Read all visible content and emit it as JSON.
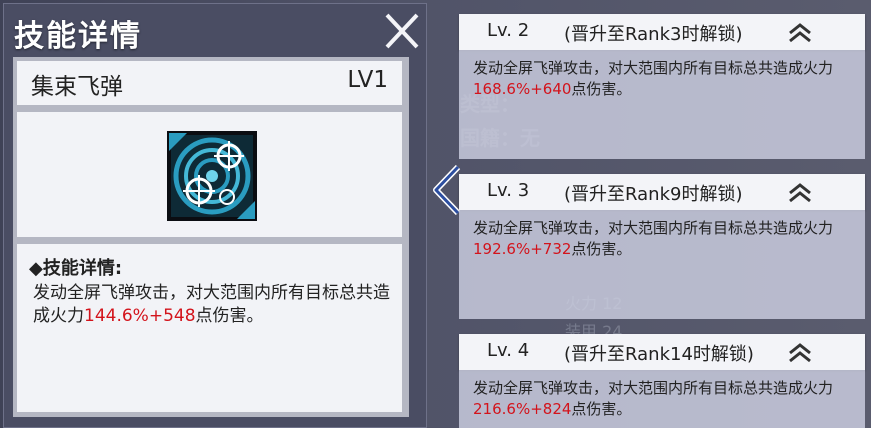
{
  "panel": {
    "title": "技能详情",
    "close_icon": "close-x-icon",
    "skill_name": "集束飞弹",
    "skill_level": "LV1",
    "skill_icon": "multi-target-reticle-icon",
    "desc_header": "◆技能详情:",
    "desc_prefix": "发动全屏飞弹攻击，对大范围内所有目标总共造成火力",
    "desc_pct": "144.6%",
    "desc_plus": "+",
    "desc_flat": "548",
    "desc_suffix": "点伤害。"
  },
  "arrow_icon": "chevron-left-icon",
  "levels": [
    {
      "lv": "Lv. 2",
      "unlock": "(晋升至Rank3时解锁)",
      "prefix": "发动全屏飞弹攻击，对大范围内所有目标总共造成火力",
      "pct": "168.6%",
      "plus": "+",
      "flat": "640",
      "suffix": "点伤害。"
    },
    {
      "lv": "Lv. 3",
      "unlock": "(晋升至Rank9时解锁)",
      "prefix": "发动全屏飞弹攻击，对大范围内所有目标总共造成火力",
      "pct": "192.6%",
      "plus": "+",
      "flat": "732",
      "suffix": "点伤害。"
    },
    {
      "lv": "Lv. 4",
      "unlock": "(晋升至Rank14时解锁)",
      "prefix": "发动全屏飞弹攻击，对大范围内所有目标总共造成火力",
      "pct": "216.6%",
      "plus": "+",
      "flat": "824",
      "suffix": "点伤害。"
    }
  ],
  "colors": {
    "highlight": "#d3131b",
    "panel": "#4a4d63",
    "card": "#f3f4f8"
  }
}
